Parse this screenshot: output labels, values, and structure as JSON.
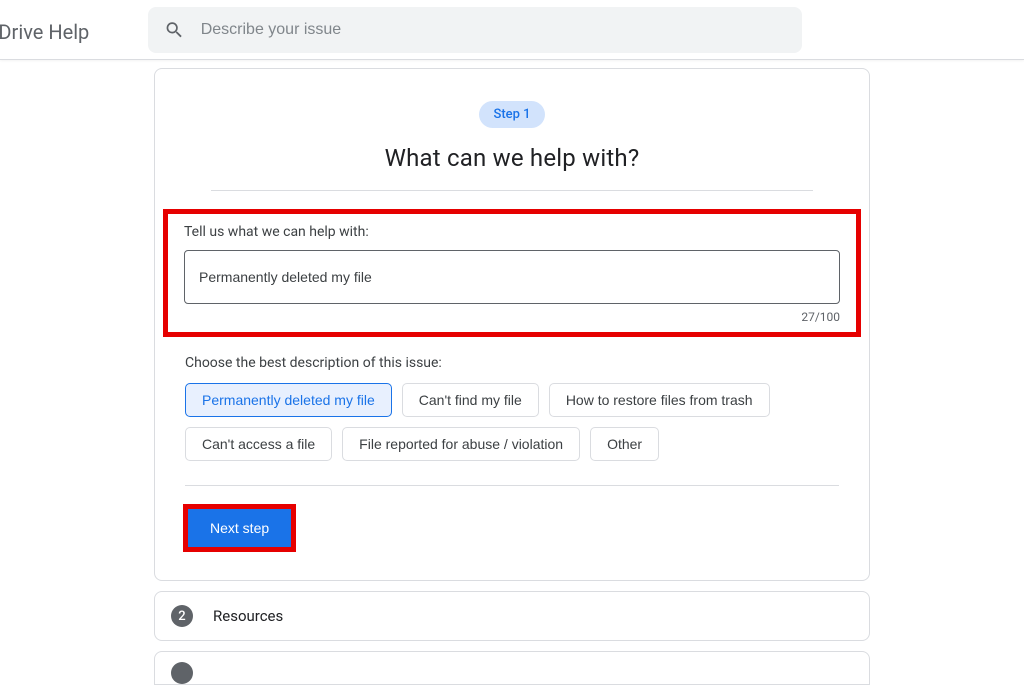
{
  "header": {
    "title": "le Drive Help",
    "search_placeholder": "Describe your issue"
  },
  "step_pill": "Step 1",
  "heading": "What can we help with?",
  "field_label": "Tell us what we can help with:",
  "issue_value": "Permanently deleted my file",
  "counter": "27/100",
  "desc_label": "Choose the best description of this issue:",
  "chips": [
    {
      "label": "Permanently deleted my file",
      "selected": true
    },
    {
      "label": "Can't find my file",
      "selected": false
    },
    {
      "label": "How to restore files from trash",
      "selected": false
    },
    {
      "label": "Can't access a file",
      "selected": false
    },
    {
      "label": "File reported for abuse / violation",
      "selected": false
    },
    {
      "label": "Other",
      "selected": false
    }
  ],
  "next_label": "Next step",
  "step2": {
    "num": "2",
    "label": "Resources"
  }
}
